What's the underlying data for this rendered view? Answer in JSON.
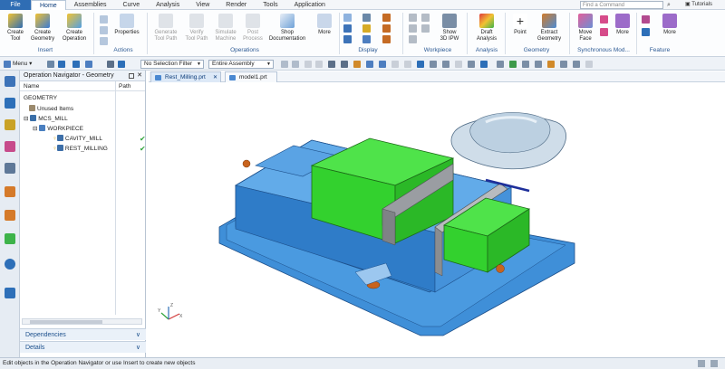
{
  "menubar": {
    "file": "File",
    "tabs": [
      "Home",
      "Assemblies",
      "Curve",
      "Analysis",
      "View",
      "Render",
      "Tools",
      "Application"
    ],
    "active_tab": "Home",
    "find_placeholder": "Find a Command",
    "tutorials": "Tutorials"
  },
  "ribbon": {
    "insert": {
      "create_tool": "Create\nTool",
      "create_geometry": "Create\nGeometry",
      "create_operation": "Create\nOperation",
      "group": "Insert"
    },
    "actions": {
      "properties": "Properties",
      "group": "Actions"
    },
    "operations": {
      "generate": "Generate\nTool Path",
      "verify": "Verify\nTool Path",
      "simulate": "Simulate\nMachine",
      "post": "Post\nProcess",
      "shop_doc": "Shop\nDocumentation",
      "more": "More",
      "group": "Operations"
    },
    "display": {
      "group": "Display"
    },
    "workpiece": {
      "show_ipw": "Show\n3D IPW",
      "group": "Workpiece"
    },
    "analysis": {
      "draft": "Draft\nAnalysis",
      "group": "Analysis"
    },
    "geometry": {
      "point": "Point",
      "extract": "Extract\nGeometry",
      "group": "Geometry"
    },
    "sync": {
      "move_face": "Move\nFace",
      "more": "More",
      "group": "Synchronous Mod..."
    },
    "feature": {
      "more": "More",
      "group": "Feature"
    }
  },
  "toolbar2": {
    "menu": "Menu",
    "selection_filter": "No Selection Filter",
    "assembly_scope": "Entire Assembly"
  },
  "navigator": {
    "title": "Operation Navigator - Geometry",
    "columns": [
      "Name",
      "Path"
    ],
    "rows": [
      {
        "label": "GEOMETRY",
        "indent": 0,
        "tick": false
      },
      {
        "label": "Unused Items",
        "indent": 1,
        "tick": false
      },
      {
        "label": "MCS_MILL",
        "indent": 1,
        "tick": false
      },
      {
        "label": "WORKPIECE",
        "indent": 2,
        "tick": false
      },
      {
        "label": "CAVITY_MILL",
        "indent": 3,
        "tick": true
      },
      {
        "label": "REST_MILLING",
        "indent": 3,
        "tick": true
      }
    ],
    "dependencies": "Dependencies",
    "details": "Details"
  },
  "doc_tabs": [
    {
      "label": "Rest_Milling.prt",
      "active": true
    },
    {
      "label": "model1.prt",
      "active": false
    }
  ],
  "status": "Edit objects in the Operation Navigator or use Insert to create new objects",
  "colors": {
    "file_tab": "#2f6db4",
    "body_blue": "#3f8fd8",
    "jaw_green": "#33d12e",
    "block_gray": "#9a9da2",
    "nose_copper": "#c8631d"
  }
}
